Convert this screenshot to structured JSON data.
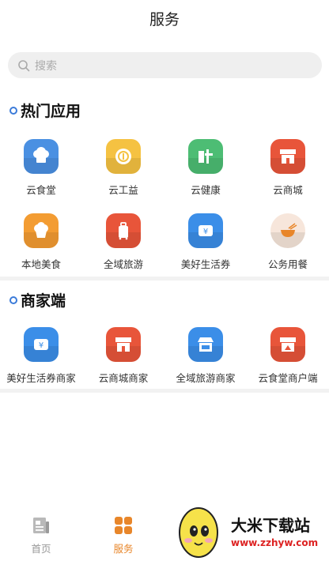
{
  "header": {
    "title": "服务"
  },
  "search": {
    "placeholder": "搜索"
  },
  "sections": {
    "popular": {
      "title": "热门应用",
      "items": [
        {
          "label": "云食堂",
          "icon": "chef-hat-icon",
          "color": "#4a90e2"
        },
        {
          "label": "云工益",
          "icon": "coin-badge-icon",
          "color": "#f5c242"
        },
        {
          "label": "云健康",
          "icon": "health-icon",
          "color": "#4dbd74"
        },
        {
          "label": "云商城",
          "icon": "shop-icon",
          "color": "#e8553a"
        },
        {
          "label": "本地美食",
          "icon": "cupcake-icon",
          "color": "#f39c32"
        },
        {
          "label": "全域旅游",
          "icon": "luggage-icon",
          "color": "#e8553a"
        },
        {
          "label": "美好生活券",
          "icon": "ticket-icon",
          "color": "#3b8ee8"
        },
        {
          "label": "公务用餐",
          "icon": "bowl-icon",
          "color": "#f7e6db"
        }
      ]
    },
    "merchant": {
      "title": "商家端",
      "items": [
        {
          "label": "美好生活券商家",
          "icon": "ticket-icon",
          "color": "#3b8ee8"
        },
        {
          "label": "云商城商家",
          "icon": "shop-icon",
          "color": "#e8553a"
        },
        {
          "label": "全域旅游商家",
          "icon": "storefront-icon",
          "color": "#3b8ee8"
        },
        {
          "label": "云食堂商户端",
          "icon": "stall-icon",
          "color": "#e8553a"
        }
      ]
    }
  },
  "tabbar": {
    "items": [
      {
        "label": "首页",
        "active": false
      },
      {
        "label": "服务",
        "active": true
      }
    ],
    "active_color": "#e8862a",
    "inactive_color": "#999999"
  },
  "watermark": {
    "title": "大米下载站",
    "url": "www.zzhyw.com"
  }
}
